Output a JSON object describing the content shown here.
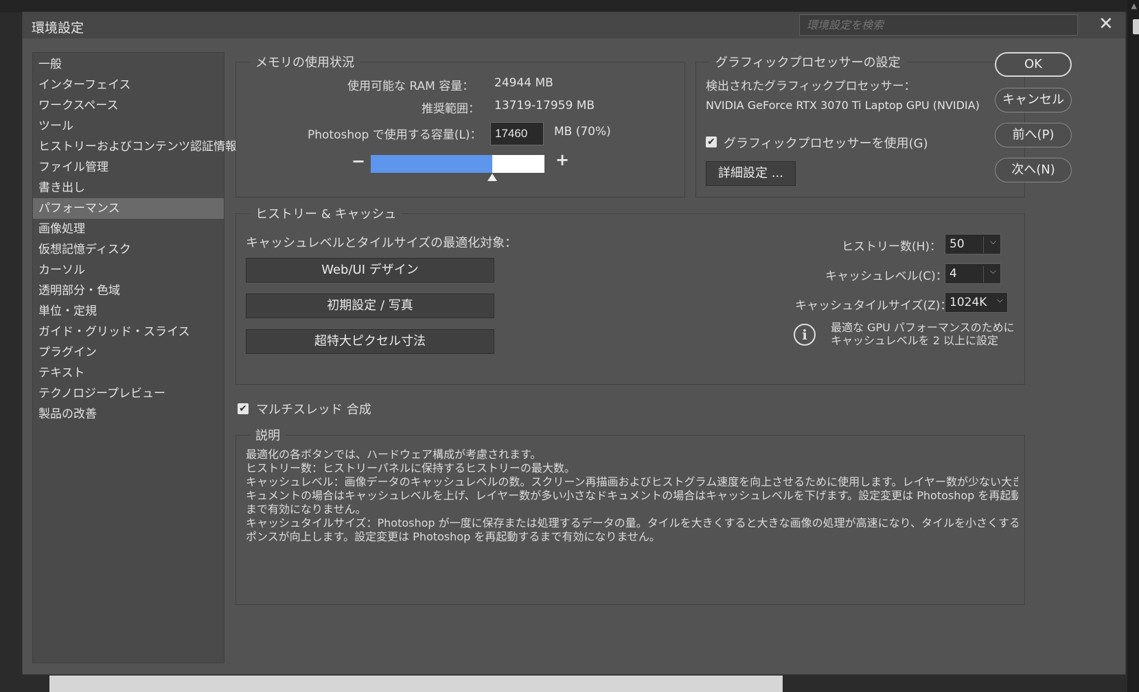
{
  "dialog": {
    "title": "環境設定",
    "search_placeholder": "環境設定を検索",
    "close_glyph": "✕"
  },
  "sidebar": {
    "items": [
      {
        "label": "一般"
      },
      {
        "label": "インターフェイス"
      },
      {
        "label": "ワークスペース"
      },
      {
        "label": "ツール"
      },
      {
        "label": "ヒストリーおよびコンテンツ認証情報"
      },
      {
        "label": "ファイル管理"
      },
      {
        "label": "書き出し"
      },
      {
        "label": "パフォーマンス",
        "active": true
      },
      {
        "label": "画像処理"
      },
      {
        "label": "仮想記憶ディスク"
      },
      {
        "label": "カーソル"
      },
      {
        "label": "透明部分・色域"
      },
      {
        "label": "単位・定規"
      },
      {
        "label": "ガイド・グリッド・スライス"
      },
      {
        "label": "プラグイン"
      },
      {
        "label": "テキスト"
      },
      {
        "label": "テクノロジープレビュー"
      },
      {
        "label": "製品の改善"
      }
    ]
  },
  "memory": {
    "legend": "メモリの使用状況",
    "ram_label": "使用可能な RAM 容量：",
    "ram_value": "24944 MB",
    "range_label": "推奨範囲：",
    "range_value": "13719-17959 MB",
    "use_label": "Photoshop で使用する容量(L)：",
    "use_value": "17460",
    "use_unit": "MB (70%)",
    "slider_fraction": 0.7,
    "minus_glyph": "−",
    "plus_glyph": "+"
  },
  "gpu": {
    "legend": "グラフィックプロセッサーの設定",
    "detected_label": "検出されたグラフィックプロセッサー：",
    "detected_value": "NVIDIA GeForce RTX 3070 Ti Laptop GPU (NVIDIA)",
    "use_gpu_label": "グラフィックプロセッサーを使用(G)",
    "use_gpu_checked": true,
    "advanced_button": "詳細設定 ..."
  },
  "buttons": {
    "ok": "OK",
    "cancel": "キャンセル",
    "prev": "前へ(P)",
    "next": "次へ(N)"
  },
  "history_cache": {
    "legend": "ヒストリー & キャッシュ",
    "optimize_label": "キャッシュレベルとタイルサイズの最適化対象：",
    "web_ui_button": "Web/UI デザイン",
    "default_photo_button": "初期設定 / 写真",
    "huge_pixel_button": "超特大ピクセル寸法",
    "history_states_label": "ヒストリー数(H)：",
    "history_states_value": "50",
    "cache_levels_label": "キャッシュレベル(C)：",
    "cache_levels_value": "4",
    "cache_tile_label": "キャッシュタイルサイズ(Z)：",
    "cache_tile_value": "1024K",
    "info_line1": "最適な GPU パフォーマンスのために",
    "info_line2": "キャッシュレベルを 2 以上に設定",
    "info_glyph": "i",
    "chevron_glyph": "⌵"
  },
  "multithread": {
    "label": "マルチスレッド 合成",
    "checked": true,
    "check_glyph": "✔"
  },
  "description": {
    "legend": "説明",
    "lines": [
      "最適化の各ボタンでは、ハードウェア構成が考慮されます。",
      "ヒストリー数：ヒストリーパネルに保持するヒストリーの最大数。",
      "キャッシュレベル：画像データのキャッシュレベルの数。スクリーン再描画およびヒストグラム速度を向上させるために使用します。レイヤー数が少ない大きなド",
      "キュメントの場合はキャッシュレベルを上げ、レイヤー数が多い小さなドキュメントの場合はキャッシュレベルを下げます。設定変更は Photoshop を再起動する",
      "まで有効になりません。",
      "キャッシュタイルサイズ：Photoshop が一度に保存または処理するデータの量。タイルを大きくすると大きな画像の処理が高速になり、タイルを小さくするとレス",
      "ポンスが向上します。設定変更は Photoshop を再起動するまで有効になりません。"
    ]
  }
}
